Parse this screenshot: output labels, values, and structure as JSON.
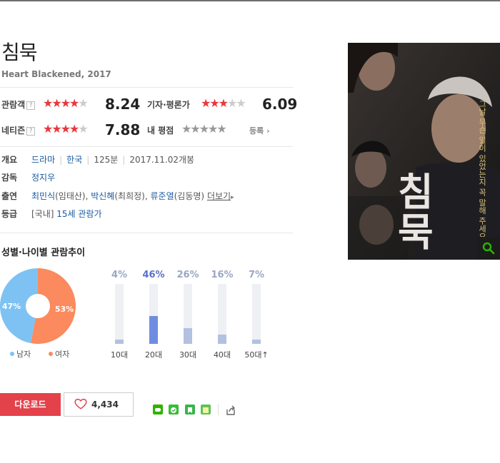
{
  "movie": {
    "title": "침묵",
    "subtitle": "Heart Blackened, 2017"
  },
  "ratings": {
    "audience": {
      "label": "관람객",
      "score": "8.24",
      "stars": 4
    },
    "critics": {
      "label": "기자·평론가",
      "score": "6.09",
      "stars": 3
    },
    "netizen": {
      "label": "네티즌",
      "score": "7.88",
      "stars": 4
    },
    "mine": {
      "label": "내 평점",
      "register": "등록",
      "stars": 0
    }
  },
  "help_mark": "?",
  "info": {
    "overview_label": "개요",
    "genre": "드라마",
    "country": "한국",
    "runtime": "125분",
    "release": "2017.11.02개봉",
    "director_label": "감독",
    "director": "정지우",
    "cast_label": "출연",
    "cast": [
      {
        "name": "최민식",
        "role": "(임태산)"
      },
      {
        "name": "박신혜",
        "role": "(최희정)"
      },
      {
        "name": "류준열",
        "role": "(김동명)"
      }
    ],
    "more": "더보기",
    "rating_label": "등급",
    "rating_prefix": "[국내]",
    "rating_value": "15세 관람가"
  },
  "demographics": {
    "title": "성별·나이별 관람추이",
    "gender": {
      "male_pct": 47,
      "female_pct": 53,
      "male_label": "47%",
      "female_label": "53%",
      "male_legend": "남자",
      "female_legend": "여자",
      "male_color": "#7ec2f3",
      "female_color": "#fb8a5e"
    },
    "ages": [
      {
        "label": "10대",
        "pct": 4,
        "pct_text": "4%"
      },
      {
        "label": "20대",
        "pct": 46,
        "pct_text": "46%"
      },
      {
        "label": "30대",
        "pct": 26,
        "pct_text": "26%"
      },
      {
        "label": "40대",
        "pct": 16,
        "pct_text": "16%"
      },
      {
        "label": "50대↑",
        "pct": 7,
        "pct_text": "7%"
      }
    ]
  },
  "actions": {
    "download": "다운로드",
    "like_count": "4,434"
  },
  "poster": {
    "title_text": "침묵",
    "tagline": "그날 무슨 일이 있었는지 꼭 말해 주세요"
  },
  "colors": {
    "accent_red": "#e4424b",
    "star_red": "#e8383d",
    "link_blue": "#1a5aa0"
  }
}
